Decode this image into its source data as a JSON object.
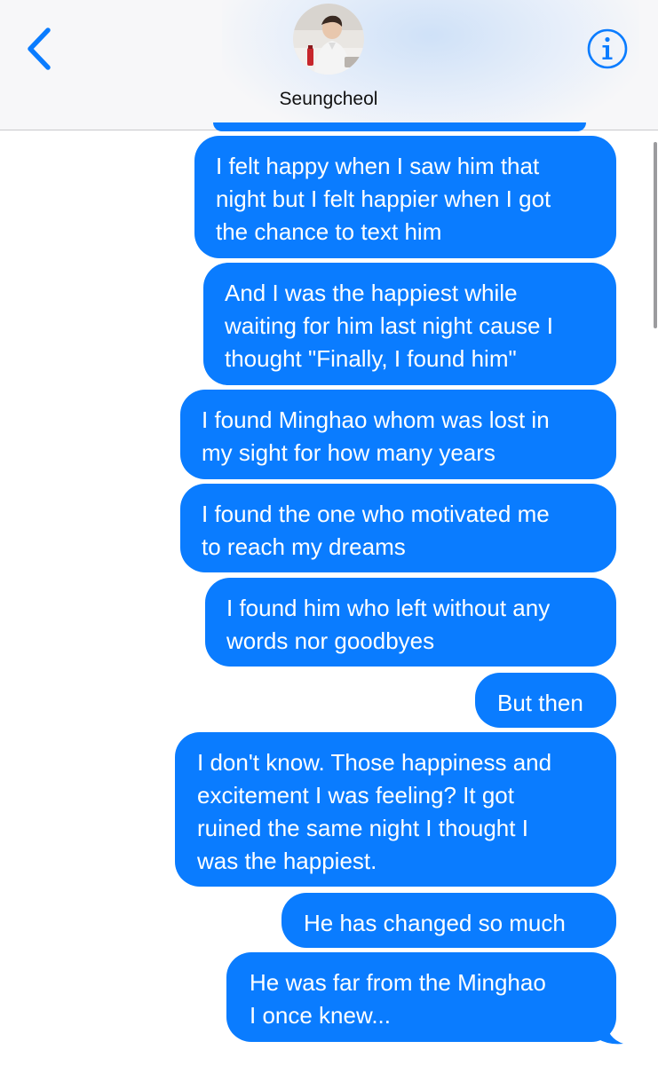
{
  "header": {
    "contact_name": "Seungcheol",
    "back_icon": "chevron-left-icon",
    "info_icon": "info-circle-icon",
    "accent_color": "#0a7cff"
  },
  "messages": [
    {
      "text": "I felt happy when I saw him that\nnight but I felt happier when I got\nthe chance to text him"
    },
    {
      "text": "And I was the happiest while\nwaiting for him last night cause I\nthought \"Finally, I found him\""
    },
    {
      "text": "I found Minghao whom was lost in\nmy sight for how many years"
    },
    {
      "text": "I found the one who motivated me\nto reach my dreams"
    },
    {
      "text": "I found him who left without any\nwords nor goodbyes"
    },
    {
      "text": "But then"
    },
    {
      "text": "I don't know. Those happiness and\nexcitement I was feeling? It got\nruined the same night I thought I\nwas the happiest."
    },
    {
      "text": "He has changed so much"
    },
    {
      "text": "He was far from the Minghao\nI once knew..."
    }
  ],
  "bubble_color": "#0a7cff"
}
